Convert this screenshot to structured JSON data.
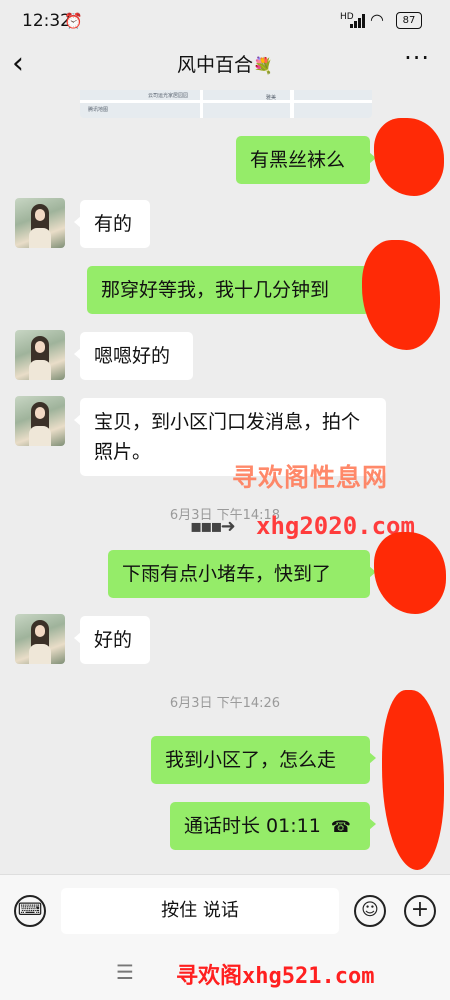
{
  "status_bar": {
    "time": "12:32",
    "alarm_icon": "alarm-icon",
    "network": "HD",
    "wifi_icon": "wifi-icon",
    "battery": "87"
  },
  "header": {
    "back_icon": "chevron-left-icon",
    "title": "风中百合",
    "title_emoji": "💐",
    "more_icon": "more-dots-icon"
  },
  "map_preview": {
    "labels": [
      "腾讯地图",
      "云司运光家居园园",
      "雅美"
    ]
  },
  "messages": [
    {
      "side": "right",
      "text": "有黑丝袜么"
    },
    {
      "side": "left",
      "text": "有的"
    },
    {
      "side": "right",
      "text": "那穿好等我，我十几分钟到"
    },
    {
      "side": "left",
      "text": "嗯嗯好的"
    },
    {
      "side": "left",
      "text": "宝贝，到小区门口发消息，拍个照片。"
    },
    {
      "side": "right",
      "text": "下雨有点小堵车，快到了"
    },
    {
      "side": "left",
      "text": "好的"
    },
    {
      "side": "right",
      "text": "我到小区了，怎么走"
    },
    {
      "side": "right",
      "text": "通话时长 01:11"
    }
  ],
  "timestamps": [
    "6月3日 下午14:18",
    "6月3日 下午14:26"
  ],
  "watermarks": {
    "site_name": "寻欢阁性息网",
    "site_url": "xhg2020.com",
    "footer": "寻欢阁xhg521.com"
  },
  "input_bar": {
    "voice_toggle_icon": "keyboard-icon",
    "hold_to_talk": "按住 说话",
    "emoji_icon": "emoji-icon",
    "plus_icon": "plus-icon"
  },
  "bottom_nav": {
    "menu_icon": "menu-icon"
  },
  "colors": {
    "outgoing_bubble": "#95ec69",
    "incoming_bubble": "#ffffff",
    "background": "#ededed",
    "redaction": "#ff2a06"
  }
}
